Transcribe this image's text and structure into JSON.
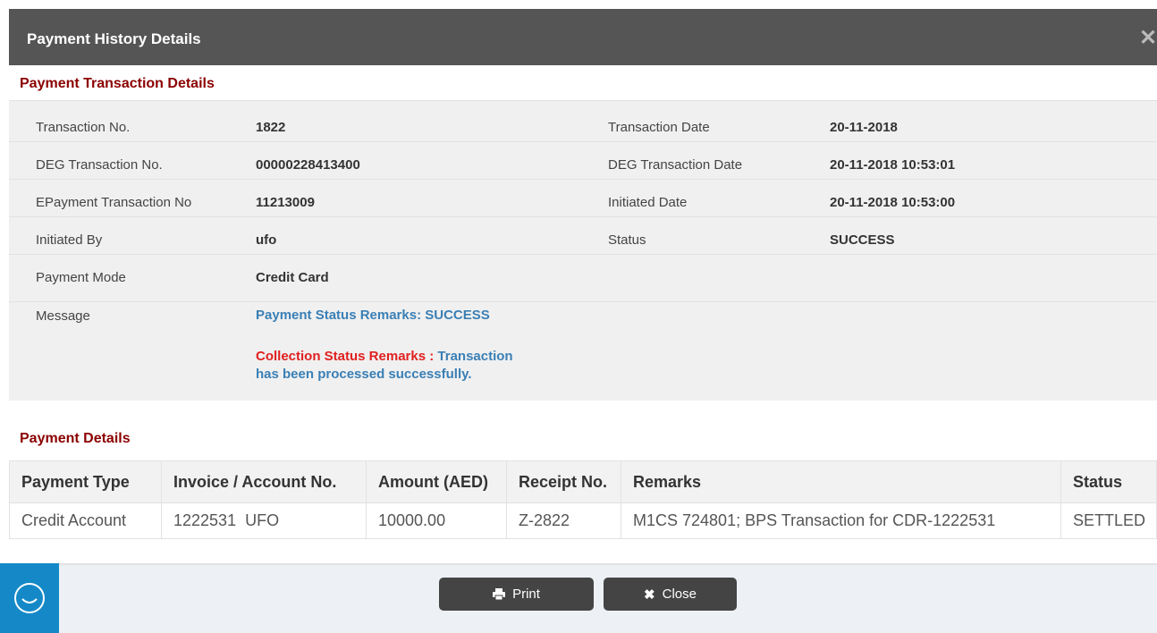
{
  "modal": {
    "title": "Payment History Details",
    "close_icon": "close-icon"
  },
  "transaction_section": {
    "title": "Payment Transaction Details",
    "left": [
      {
        "label": "Transaction No.",
        "value": "1822"
      },
      {
        "label": "DEG Transaction No.",
        "value": "00000228413400"
      },
      {
        "label": "EPayment Transaction No",
        "value": "11213009"
      },
      {
        "label": "Initiated By",
        "value": "ufo"
      },
      {
        "label": "Payment Mode",
        "value": "Credit Card"
      }
    ],
    "right": [
      {
        "label": "Transaction Date",
        "value": "20-11-2018"
      },
      {
        "label": "DEG Transaction Date",
        "value": "20-11-2018 10:53:01"
      },
      {
        "label": "Initiated Date",
        "value": "20-11-2018 10:53:00"
      },
      {
        "label": "Status",
        "value": "SUCCESS"
      }
    ],
    "message": {
      "label": "Message",
      "payment_status_remarks": "Payment Status Remarks: SUCCESS",
      "collection_label": "Collection Status Remarks :",
      "collection_text_line1": "Transaction",
      "collection_text_line2": "has been processed successfully."
    }
  },
  "payment_section": {
    "title": "Payment Details",
    "columns": [
      "Payment Type",
      "Invoice / Account No.",
      "Amount (AED)",
      "Receipt No.",
      "Remarks",
      "Status"
    ],
    "rows": [
      [
        "Credit Account",
        "1222531  UFO",
        "10000.00",
        "Z-2822",
        "M1CS 724801; BPS Transaction for CDR-1222531",
        "SETTLED"
      ]
    ]
  },
  "footer": {
    "print_label": "Print",
    "close_label": "Close",
    "print_icon": "print-icon",
    "close_icon": "close-icon"
  },
  "colors": {
    "header_bg": "#555555",
    "section_title": "#8b0000",
    "remark_blue": "#3a7fb5",
    "remark_red": "#e02020",
    "chat_blue": "#1589c7"
  }
}
